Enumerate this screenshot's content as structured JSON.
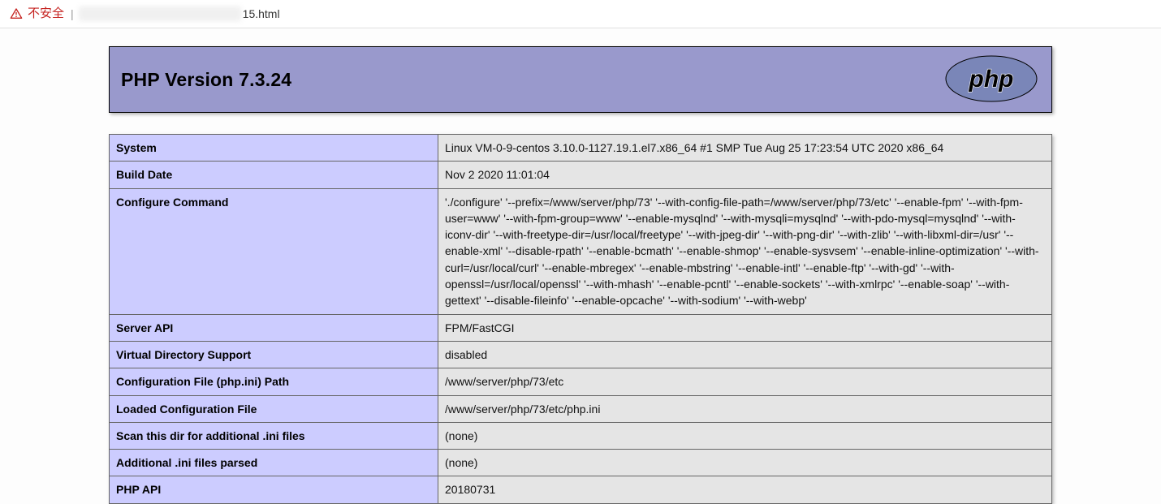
{
  "address_bar": {
    "insecure_label": "不安全",
    "url_tail": "15.html"
  },
  "header": {
    "title": "PHP Version 7.3.24",
    "logo_text": "php"
  },
  "rows": [
    {
      "label": "System",
      "value": "Linux VM-0-9-centos 3.10.0-1127.19.1.el7.x86_64 #1 SMP Tue Aug 25 17:23:54 UTC 2020 x86_64"
    },
    {
      "label": "Build Date",
      "value": "Nov 2 2020 11:01:04"
    },
    {
      "label": "Configure Command",
      "value": "'./configure' '--prefix=/www/server/php/73' '--with-config-file-path=/www/server/php/73/etc' '--enable-fpm' '--with-fpm-user=www' '--with-fpm-group=www' '--enable-mysqlnd' '--with-mysqli=mysqlnd' '--with-pdo-mysql=mysqlnd' '--with-iconv-dir' '--with-freetype-dir=/usr/local/freetype' '--with-jpeg-dir' '--with-png-dir' '--with-zlib' '--with-libxml-dir=/usr' '--enable-xml' '--disable-rpath' '--enable-bcmath' '--enable-shmop' '--enable-sysvsem' '--enable-inline-optimization' '--with-curl=/usr/local/curl' '--enable-mbregex' '--enable-mbstring' '--enable-intl' '--enable-ftp' '--with-gd' '--with-openssl=/usr/local/openssl' '--with-mhash' '--enable-pcntl' '--enable-sockets' '--with-xmlrpc' '--enable-soap' '--with-gettext' '--disable-fileinfo' '--enable-opcache' '--with-sodium' '--with-webp'"
    },
    {
      "label": "Server API",
      "value": "FPM/FastCGI"
    },
    {
      "label": "Virtual Directory Support",
      "value": "disabled"
    },
    {
      "label": "Configuration File (php.ini) Path",
      "value": "/www/server/php/73/etc"
    },
    {
      "label": "Loaded Configuration File",
      "value": "/www/server/php/73/etc/php.ini"
    },
    {
      "label": "Scan this dir for additional .ini files",
      "value": "(none)"
    },
    {
      "label": "Additional .ini files parsed",
      "value": "(none)"
    },
    {
      "label": "PHP API",
      "value": "20180731"
    }
  ]
}
